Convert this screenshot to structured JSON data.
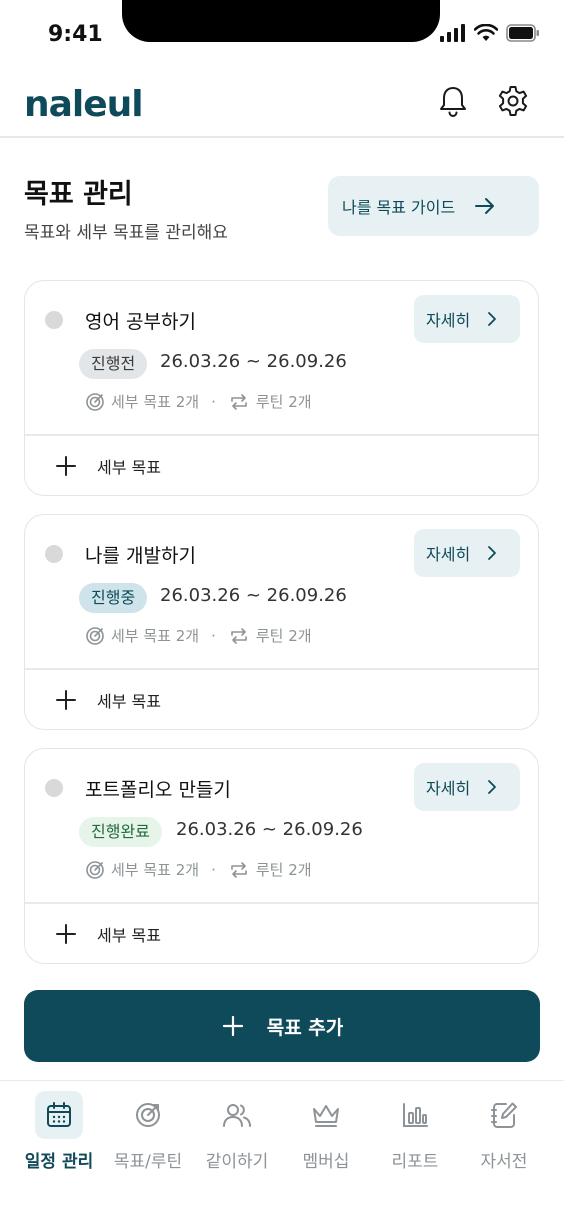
{
  "status_bar": {
    "time": "9:41"
  },
  "header": {
    "logo": "naleul",
    "notification_icon": "bell-icon",
    "settings_icon": "gear-icon"
  },
  "page": {
    "title": "목표 관리",
    "subtitle": "목표와 세부 목표를 관리해요",
    "guide_button": "나를 목표 가이드"
  },
  "goals": [
    {
      "title": "영어 공부하기",
      "status": "진행전",
      "dates": "26.03.26 ~ 26.09.26",
      "sub_goals": "세부 목표 2개",
      "separator": "·",
      "routines": "루틴 2개",
      "detail_button": "자세히",
      "add_sub_goal": "세부 목표"
    },
    {
      "title": "나를 개발하기",
      "status": "진행중",
      "dates": "26.03.26 ~ 26.09.26",
      "sub_goals": "세부 목표 2개",
      "separator": "·",
      "routines": "루틴 2개",
      "detail_button": "자세히",
      "add_sub_goal": "세부 목표"
    },
    {
      "title": "포트폴리오 만들기",
      "status": "진행완료",
      "dates": "26.03.26 ~ 26.09.26",
      "sub_goals": "세부 목표 2개",
      "separator": "·",
      "routines": "루틴 2개",
      "detail_button": "자세히",
      "add_sub_goal": "세부 목표"
    }
  ],
  "add_goal_button": "목표 추가",
  "bottom_nav": [
    {
      "label": "일정 관리",
      "icon": "calendar-icon",
      "active": true
    },
    {
      "label": "목표/루틴",
      "icon": "target-icon",
      "active": false
    },
    {
      "label": "같이하기",
      "icon": "users-icon",
      "active": false
    },
    {
      "label": "멤버십",
      "icon": "crown-icon",
      "active": false
    },
    {
      "label": "리포트",
      "icon": "bar-chart-icon",
      "active": false
    },
    {
      "label": "자서전",
      "icon": "notebook-pen-icon",
      "active": false
    }
  ],
  "colors": {
    "brand": "#0e4a59",
    "accent_bg": "#e7f1f3",
    "muted": "#8d9396"
  }
}
